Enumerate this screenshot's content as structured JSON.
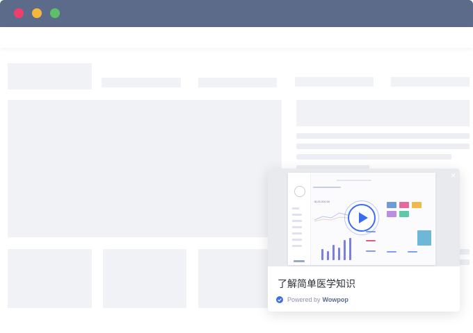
{
  "window": {
    "buttons": [
      {
        "name": "close",
        "color": "#ef3e6b"
      },
      {
        "name": "minimize",
        "color": "#f4b73e"
      },
      {
        "name": "maximize",
        "color": "#5ec16a"
      }
    ]
  },
  "popup": {
    "title": "了解简单医学知识",
    "powered_prefix": "Powered by",
    "powered_brand": "Wowpop",
    "close_glyph": "×",
    "accent_color": "#3b6cf0"
  },
  "video_preview": {
    "amount": "$120,000.00"
  }
}
